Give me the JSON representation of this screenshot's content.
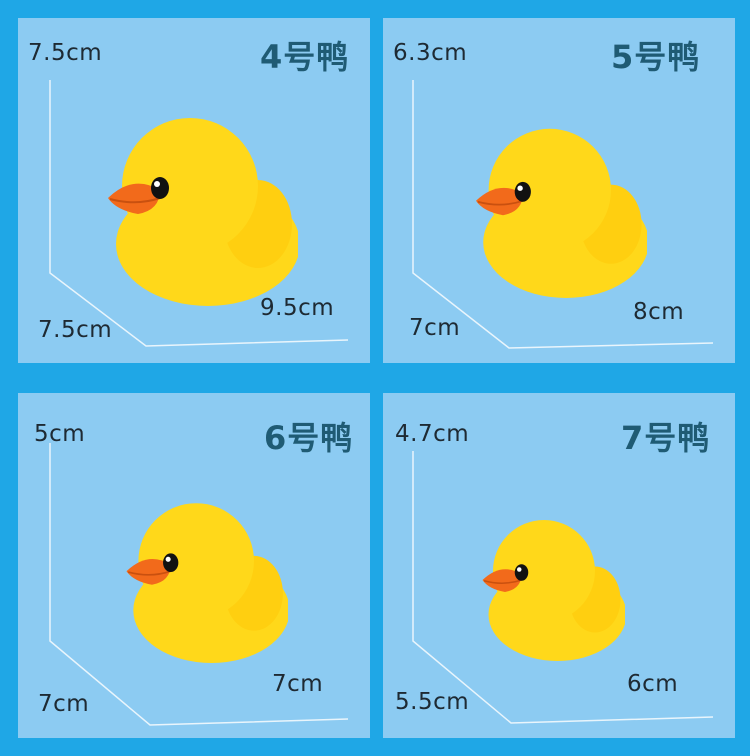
{
  "colors": {
    "background": "#1fa7e6",
    "panel": "#8ccbf2",
    "title": "#1f5b74",
    "label": "#1e2a33",
    "duck_body": "#ffd81a",
    "duck_beak": "#f26a1b"
  },
  "panels": [
    {
      "title": "4号鸭",
      "height_label": "7.5cm",
      "depth_label": "7.5cm",
      "width_label": "9.5cm"
    },
    {
      "title": "5号鸭",
      "height_label": "6.3cm",
      "depth_label": "7cm",
      "width_label": "8cm"
    },
    {
      "title": "6号鸭",
      "height_label": "5cm",
      "depth_label": "7cm",
      "width_label": "7cm"
    },
    {
      "title": "7号鸭",
      "height_label": "4.7cm",
      "depth_label": "5.5cm",
      "width_label": "6cm"
    }
  ]
}
